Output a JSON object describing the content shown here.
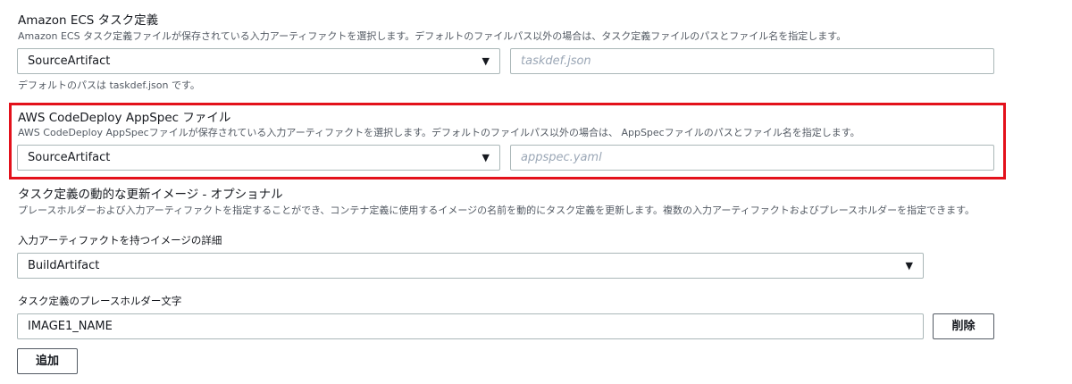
{
  "ecs_task_def": {
    "title": "Amazon ECS タスク定義",
    "description": "Amazon ECS タスク定義ファイルが保存されている入力アーティファクトを選択します。デフォルトのファイルパス以外の場合は、タスク定義ファイルのパスとファイル名を指定します。",
    "artifact_select": {
      "value": "SourceArtifact"
    },
    "path_input": {
      "value": "",
      "placeholder": "taskdef.json"
    },
    "hint": "デフォルトのパスは taskdef.json です。"
  },
  "appspec": {
    "title": "AWS CodeDeploy AppSpec ファイル",
    "description": "AWS CodeDeploy AppSpecファイルが保存されている入力アーティファクトを選択します。デフォルトのファイルパス以外の場合は、 AppSpecファイルのパスとファイル名を指定します。",
    "artifact_select": {
      "value": "SourceArtifact"
    },
    "path_input": {
      "value": "",
      "placeholder": "appspec.yaml"
    },
    "highlight_color": "#e3111b"
  },
  "dynamic_image": {
    "title": "タスク定義の動的な更新イメージ - オプショナル",
    "description": "プレースホルダーおよび入力アーティファクトを指定することができ、コンテナ定義に使用するイメージの名前を動的にタスク定義を更新します。複数の入力アーティファクトおよびプレースホルダーを指定できます。",
    "image_details_label": "入力アーティファクトを持つイメージの詳細",
    "image_select": {
      "value": "BuildArtifact"
    },
    "placeholder_label": "タスク定義のプレースホルダー文字",
    "placeholder_input": {
      "value": "IMAGE1_NAME"
    },
    "remove_button": "削除",
    "add_button": "追加"
  },
  "icons": {
    "caret": "▼"
  }
}
